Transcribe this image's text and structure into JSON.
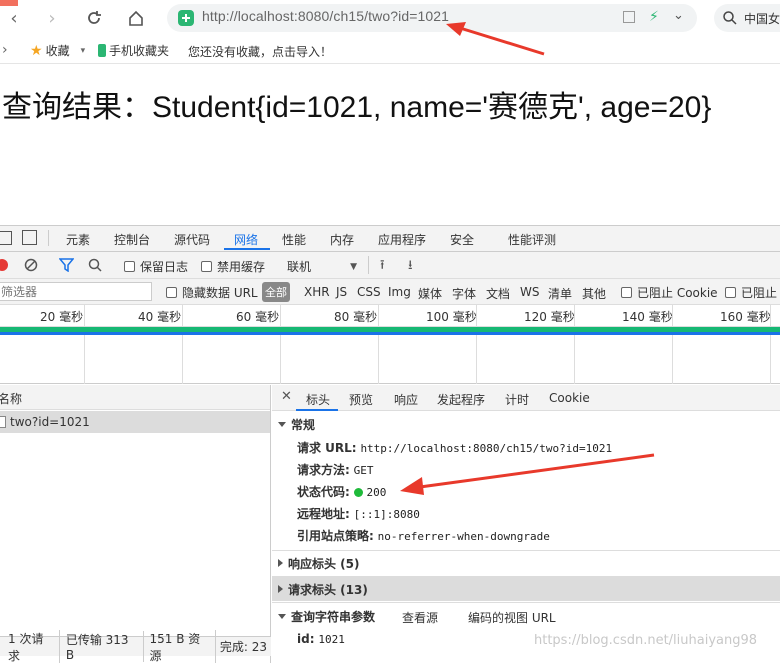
{
  "browser": {
    "url": "http://localhost:8080/ch15/two?id=1021",
    "search_text": "中国女",
    "bookmarks": {
      "favorites_label": "收藏",
      "mobile_label": "手机收藏夹",
      "empty_hint": "您还没有收藏，点击导入！"
    }
  },
  "page": {
    "result_text": "查询结果：Student{id=1021, name='赛德克', age=20}"
  },
  "devtools": {
    "tabs": [
      "元素",
      "控制台",
      "源代码",
      "网络",
      "性能",
      "内存",
      "应用程序",
      "安全",
      "性能评测"
    ],
    "toolbar": {
      "preserve_log": "保留日志",
      "disable_cache": "禁用缓存",
      "throttling": "联机"
    },
    "filter": {
      "placeholder": "筛选器",
      "hide_data_urls": "隐藏数据 URL",
      "types": [
        "全部",
        "XHR",
        "JS",
        "CSS",
        "Img",
        "媒体",
        "字体",
        "文档",
        "WS",
        "清单",
        "其他"
      ],
      "blocked_cookies": "已阻止 Cookie",
      "blocked_requests": "已阻止"
    },
    "timeline_ticks": [
      "20 毫秒",
      "40 毫秒",
      "60 毫秒",
      "80 毫秒",
      "100 毫秒",
      "120 毫秒",
      "140 毫秒",
      "160 毫秒"
    ],
    "request_list": {
      "header": "名称",
      "items": [
        "two?id=1021"
      ]
    },
    "detail_tabs": [
      "标头",
      "预览",
      "响应",
      "发起程序",
      "计时",
      "Cookie"
    ],
    "general": {
      "title": "常规",
      "request_url_label": "请求 URL:",
      "request_url": "http://localhost:8080/ch15/two?id=1021",
      "method_label": "请求方法:",
      "method": "GET",
      "status_label": "状态代码:",
      "status": "200",
      "remote_label": "远程地址:",
      "remote": "[::1]:8080",
      "referrer_label": "引用站点策略:",
      "referrer": "no-referrer-when-downgrade"
    },
    "response_headers": "响应标头 (5)",
    "request_headers": "请求标头 (13)",
    "query_params": {
      "title": "查询字符串参数",
      "view_source": "查看源",
      "view_decoded": "编码的视图 URL",
      "key": "id:",
      "value": "1021"
    },
    "statusbar": {
      "requests": "1 次请求",
      "transferred": "已传输 313 B",
      "resources": "151 B 资源",
      "finish": "完成: 23"
    },
    "watermark": "https://blog.csdn.net/liuhaiyang98"
  },
  "colors": {
    "accent_blue": "#1a73e8",
    "arrow_red": "#e8392b",
    "status_green": "#1fba3a",
    "timeline_green": "#16b874"
  }
}
